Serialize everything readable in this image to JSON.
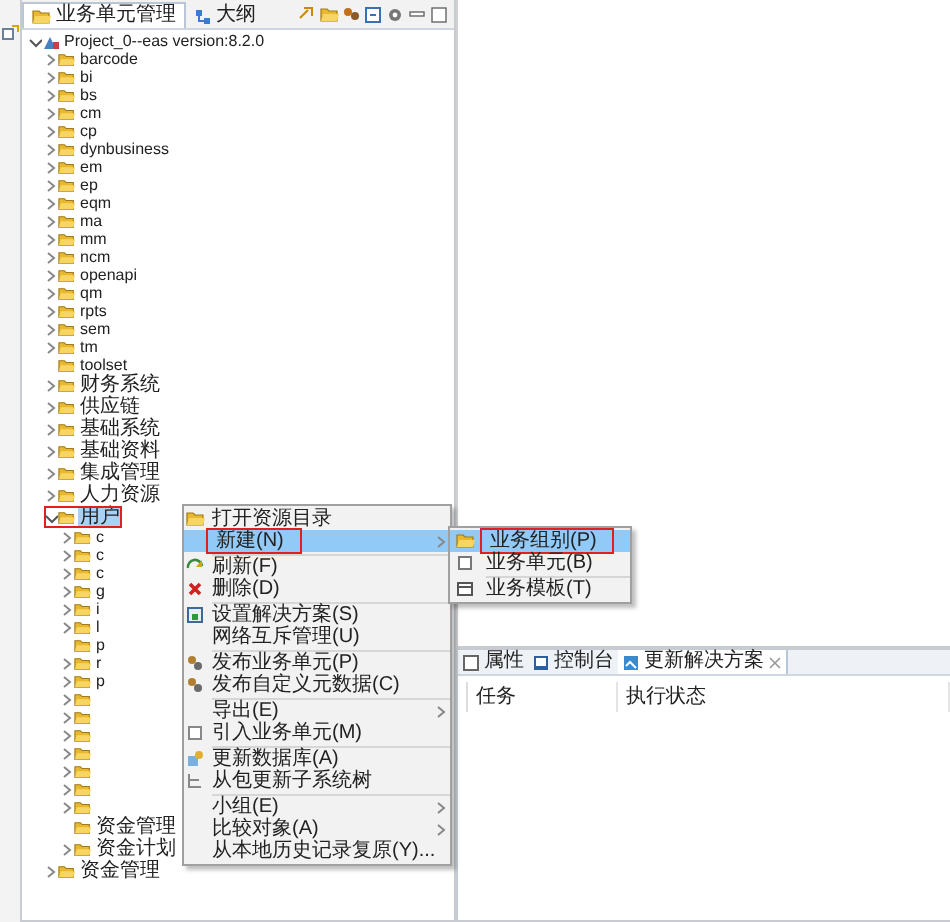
{
  "panel": {
    "tabs": [
      {
        "label": "业务单元管理",
        "selected": true
      },
      {
        "label": "大纲",
        "selected": false
      }
    ]
  },
  "tree": {
    "label": "Project_0--eas version:8.2.0",
    "expandable": true,
    "expanded": true,
    "selected": false,
    "highlighted": false,
    "children": [
      {
        "label": "barcode",
        "expandable": true,
        "expanded": false,
        "selected": false,
        "highlighted": false
      },
      {
        "label": "bi",
        "expandable": true,
        "expanded": false,
        "selected": false,
        "highlighted": false
      },
      {
        "label": "bs",
        "expandable": true,
        "expanded": false,
        "selected": false,
        "highlighted": false
      },
      {
        "label": "cm",
        "expandable": true,
        "expanded": false,
        "selected": false,
        "highlighted": false
      },
      {
        "label": "cp",
        "expandable": true,
        "expanded": false,
        "selected": false,
        "highlighted": false
      },
      {
        "label": "dynbusiness",
        "expandable": true,
        "expanded": false,
        "selected": false,
        "highlighted": false
      },
      {
        "label": "em",
        "expandable": true,
        "expanded": false,
        "selected": false,
        "highlighted": false
      },
      {
        "label": "ep",
        "expandable": true,
        "expanded": false,
        "selected": false,
        "highlighted": false
      },
      {
        "label": "eqm",
        "expandable": true,
        "expanded": false,
        "selected": false,
        "highlighted": false
      },
      {
        "label": "ma",
        "expandable": true,
        "expanded": false,
        "selected": false,
        "highlighted": false
      },
      {
        "label": "mm",
        "expandable": true,
        "expanded": false,
        "selected": false,
        "highlighted": false
      },
      {
        "label": "ncm",
        "expandable": true,
        "expanded": false,
        "selected": false,
        "highlighted": false
      },
      {
        "label": "openapi",
        "expandable": true,
        "expanded": false,
        "selected": false,
        "highlighted": false
      },
      {
        "label": "qm",
        "expandable": true,
        "expanded": false,
        "selected": false,
        "highlighted": false
      },
      {
        "label": "rpts",
        "expandable": true,
        "expanded": false,
        "selected": false,
        "highlighted": false
      },
      {
        "label": "sem",
        "expandable": true,
        "expanded": false,
        "selected": false,
        "highlighted": false
      },
      {
        "label": "tm",
        "expandable": true,
        "expanded": false,
        "selected": false,
        "highlighted": false
      },
      {
        "label": "toolset",
        "expandable": false,
        "selected": false,
        "highlighted": false
      },
      {
        "label": "财务系统",
        "expandable": true,
        "expanded": false,
        "selected": false,
        "highlighted": false
      },
      {
        "label": "供应链",
        "expandable": true,
        "expanded": false,
        "selected": false,
        "highlighted": false
      },
      {
        "label": "基础系统",
        "expandable": true,
        "expanded": false,
        "selected": false,
        "highlighted": false
      },
      {
        "label": "基础资料",
        "expandable": true,
        "expanded": false,
        "selected": false,
        "highlighted": false
      },
      {
        "label": "集成管理",
        "expandable": true,
        "expanded": false,
        "selected": false,
        "highlighted": false
      },
      {
        "label": "人力资源",
        "expandable": true,
        "expanded": false,
        "selected": false,
        "highlighted": false
      },
      {
        "label": "用户",
        "expandable": true,
        "expanded": true,
        "selected": true,
        "highlighted": true,
        "children": [
          {
            "label": "c",
            "expandable": true,
            "expanded": false,
            "selected": false,
            "highlighted": false
          },
          {
            "label": "c",
            "expandable": true,
            "expanded": false,
            "selected": false,
            "highlighted": false
          },
          {
            "label": "c",
            "expandable": true,
            "expanded": false,
            "selected": false,
            "highlighted": false
          },
          {
            "label": "g",
            "expandable": true,
            "expanded": false,
            "selected": false,
            "highlighted": false
          },
          {
            "label": "i",
            "expandable": true,
            "expanded": false,
            "selected": false,
            "highlighted": false
          },
          {
            "label": "l",
            "expandable": true,
            "expanded": false,
            "selected": false,
            "highlighted": false
          },
          {
            "label": "p",
            "expandable": false,
            "selected": false,
            "highlighted": false
          },
          {
            "label": "r",
            "expandable": true,
            "expanded": false,
            "selected": false,
            "highlighted": false
          },
          {
            "label": "p",
            "expandable": true,
            "expanded": false,
            "selected": false,
            "highlighted": false
          },
          {
            "expandable": true,
            "expanded": false,
            "highlighted": false
          },
          {
            "expandable": true,
            "expanded": false,
            "highlighted": false
          },
          {
            "expandable": true,
            "expanded": false,
            "highlighted": false
          },
          {
            "expandable": true,
            "expanded": false,
            "highlighted": false
          },
          {
            "expandable": true,
            "expanded": false,
            "highlighted": false
          },
          {
            "expandable": true,
            "expanded": false,
            "highlighted": false
          },
          {
            "expandable": true,
            "expanded": false,
            "highlighted": false
          },
          {
            "label": "资金管理",
            "expandable": false,
            "selected": false,
            "highlighted": false
          },
          {
            "label": "资金计划",
            "expandable": true,
            "expanded": false,
            "selected": false,
            "highlighted": false
          }
        ]
      },
      {
        "label": "资金管理",
        "expandable": true,
        "expanded": false,
        "selected": false,
        "highlighted": false
      }
    ]
  },
  "context_menu": {
    "items": [
      {
        "kind": "item",
        "label": "打开资源目录",
        "submenu": false,
        "selected": false,
        "highlighted": false
      },
      {
        "kind": "item",
        "label": "新建(N)",
        "submenu": true,
        "selected": true,
        "highlighted": true
      },
      {
        "kind": "separator"
      },
      {
        "kind": "item",
        "label": "刷新(F)",
        "submenu": false,
        "selected": false,
        "highlighted": false
      },
      {
        "kind": "item",
        "label": "删除(D)",
        "submenu": false,
        "selected": false,
        "highlighted": false
      },
      {
        "kind": "separator"
      },
      {
        "kind": "item",
        "label": "设置解决方案(S)",
        "submenu": false,
        "selected": false,
        "highlighted": false
      },
      {
        "kind": "item",
        "label": "网络互斥管理(U)",
        "submenu": false,
        "selected": false,
        "highlighted": false
      },
      {
        "kind": "separator"
      },
      {
        "kind": "item",
        "label": "发布业务单元(P)",
        "submenu": false,
        "selected": false,
        "highlighted": false
      },
      {
        "kind": "item",
        "label": "发布自定义元数据(C)",
        "submenu": false,
        "selected": false,
        "highlighted": false
      },
      {
        "kind": "separator"
      },
      {
        "kind": "item",
        "label": "导出(E)",
        "submenu": true,
        "selected": false,
        "highlighted": false
      },
      {
        "kind": "item",
        "label": "引入业务单元(M)",
        "submenu": false,
        "selected": false,
        "highlighted": false
      },
      {
        "kind": "separator"
      },
      {
        "kind": "item",
        "label": "更新数据库(A)",
        "submenu": false,
        "selected": false,
        "highlighted": false
      },
      {
        "kind": "item",
        "label": "从包更新子系统树",
        "submenu": false,
        "selected": false,
        "highlighted": false
      },
      {
        "kind": "separator"
      },
      {
        "kind": "item",
        "label": "小组(E)",
        "submenu": true,
        "selected": false,
        "highlighted": false
      },
      {
        "kind": "item",
        "label": "比较对象(A)",
        "submenu": true,
        "selected": false,
        "highlighted": false
      },
      {
        "kind": "item",
        "label": "从本地历史记录复原(Y)...",
        "submenu": false,
        "selected": false,
        "highlighted": false
      }
    ]
  },
  "submenu": {
    "items": [
      {
        "kind": "item",
        "label": "业务组别(P)",
        "selected": true,
        "highlighted": true
      },
      {
        "kind": "item",
        "label": "业务单元(B)",
        "selected": false,
        "highlighted": false
      },
      {
        "kind": "separator"
      },
      {
        "kind": "item",
        "label": "业务模板(T)",
        "selected": false,
        "highlighted": false
      }
    ]
  },
  "bottom_panel": {
    "tabs": [
      {
        "label": "属性",
        "selected": false
      },
      {
        "label": "控制台",
        "selected": false
      },
      {
        "label": "更新解决方案",
        "selected": true
      }
    ],
    "table": {
      "columns": [
        "任务",
        "执行状态"
      ]
    }
  }
}
